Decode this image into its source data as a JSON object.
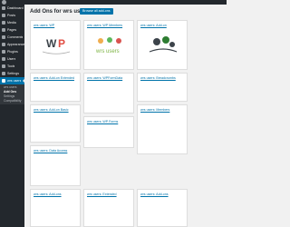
{
  "page": {
    "title": "Add Ons for wrs users",
    "search_button": "Browse all add-ons"
  },
  "sidebar": {
    "items": [
      {
        "label": "Dashboard",
        "icon": "dashboard-icon"
      },
      {
        "label": "Posts",
        "icon": "pin-icon"
      },
      {
        "label": "Media",
        "icon": "media-icon"
      },
      {
        "label": "Pages",
        "icon": "page-icon"
      },
      {
        "label": "Comments",
        "icon": "comment-icon"
      },
      {
        "label": "Appearance",
        "icon": "brush-icon"
      },
      {
        "label": "Plugins",
        "icon": "plug-icon"
      },
      {
        "label": "Users",
        "icon": "users-icon"
      },
      {
        "label": "Tools",
        "icon": "wrench-icon"
      },
      {
        "label": "Settings",
        "icon": "settings-icon"
      },
      {
        "label": "wrs users",
        "icon": "user-icon",
        "active": true
      }
    ],
    "submenu": [
      "wrs users",
      "Add Ons",
      "Settings",
      "Compatibility"
    ]
  },
  "cards": [
    {
      "title": "wrs users: WP"
    },
    {
      "title": "wrs users: WP Members"
    },
    {
      "title": "wrs users: Add-on"
    },
    {
      "title": "wrs users: Add-on Extended"
    },
    {
      "title": "wrs users: WPFormData"
    },
    {
      "title": "wrs users: Breadcrumbs"
    },
    {
      "title": "wrs users: Add-on Basic"
    },
    {
      "title": "wrs users: WP Forms"
    },
    {
      "title": "wrs users: Members"
    },
    {
      "title": "wrs users: Data Access"
    },
    {
      "title": "wrs users: Add-ons"
    },
    {
      "title": "wrs users: Extended"
    }
  ],
  "colors": {
    "sidebar_bg": "#23282d",
    "accent": "#0073aa",
    "page_bg": "#f1f1f1"
  }
}
